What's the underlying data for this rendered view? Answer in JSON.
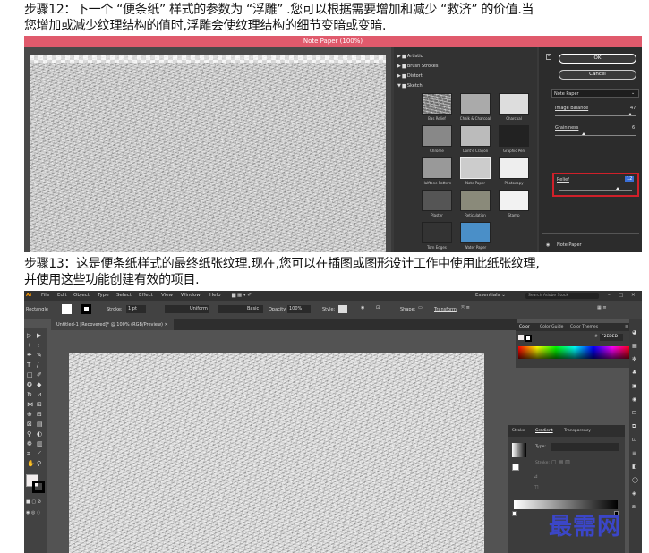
{
  "captions": {
    "step12_line1": "步骤12：下一个 “便条纸” 样式的参数为 “浮雕” .您可以根据需要增加和减少 “救济” 的价值.当",
    "step12_line2": "您增加或减少纹理结构的值时,浮雕会使纹理结构的细节变暗或变暗.",
    "step13_line1": "步骤13：这是便条纸样式的最终纸张纹理.现在,您可以在插图或图形设计工作中使用此纸张纹理,",
    "step13_line2": "并使用这些功能创建有效的项目."
  },
  "filter_gallery": {
    "title": "Note Paper (100%)",
    "categories": [
      "Artistic",
      "Brush Strokes",
      "Distort",
      "Sketch"
    ],
    "thumbnails": [
      "Bas Relief",
      "Chalk & Charcoal",
      "Charcoal",
      "Chrome",
      "Cont'e Crayon",
      "Graphic Pen",
      "Halftone Pattern",
      "Note Paper",
      "Photocopy",
      "Plaster",
      "Reticulation",
      "Stamp",
      "Torn Edges",
      "Water Paper"
    ],
    "ok_label": "OK",
    "cancel_label": "Cancel",
    "filter_select": "Note Paper",
    "image_balance_label": "Image Balance",
    "image_balance_value": "47",
    "graininess_label": "Graininess",
    "graininess_value": "6",
    "relief_label": "Relief",
    "relief_value": "12",
    "layer_label": "Note Paper",
    "highlight_color": "#d0202a"
  },
  "illustrator": {
    "app_logo": "Ai",
    "menu": [
      "File",
      "Edit",
      "Object",
      "Type",
      "Select",
      "Effect",
      "View",
      "Window",
      "Help"
    ],
    "workspace": "Essentials",
    "search_placeholder": "Search Adobe Stock",
    "control": {
      "selection": "Rectangle",
      "stroke_label": "Stroke:",
      "stroke_value": "1 pt",
      "uniform": "Uniform",
      "basic": "Basic",
      "opacity_label": "Opacity:",
      "opacity_value": "100%",
      "style_label": "Style:",
      "shape_label": "Shape:",
      "transform_label": "Transform"
    },
    "doc_tab": "Untitled-1 [Recovered]* @ 100% (RGB/Preview)",
    "color_panel": {
      "tabs": [
        "Color",
        "Color Guide",
        "Color Themes"
      ],
      "hex": "F2EDED"
    },
    "gradient_panel": {
      "tabs": [
        "Stroke",
        "Gradient",
        "Transparency"
      ],
      "type_label": "Type:",
      "stroke_label": "Stroke:"
    }
  },
  "watermark": "最需网"
}
